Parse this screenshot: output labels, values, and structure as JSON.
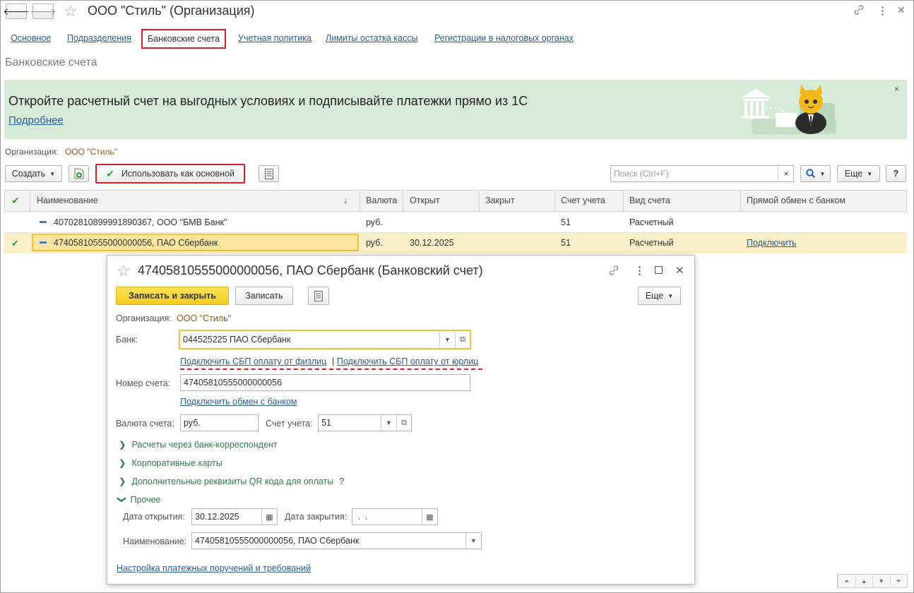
{
  "window": {
    "title": "ООО \"Стиль\" (Организация)"
  },
  "tabs": [
    {
      "label": "Основное"
    },
    {
      "label": "Подразделения"
    },
    {
      "label": "Банковские счета"
    },
    {
      "label": "Учетная политика"
    },
    {
      "label": "Лимиты остатка кассы"
    },
    {
      "label": "Регистрации в налоговых органах"
    }
  ],
  "section_title": "Банковские счета",
  "banner": {
    "text": "Откройте расчетный счет на выгодных условиях и подписывайте платежки прямо из 1С",
    "link": "Подробнее",
    "close": "×"
  },
  "org": {
    "label": "Организация:",
    "value": "ООО \"Стиль\""
  },
  "toolbar": {
    "create": "Создать",
    "use_as_main": "Использовать как основной",
    "search_placeholder": "Поиск (Ctrl+F)",
    "search_clear": "×",
    "more": "Еще",
    "help": "?"
  },
  "table": {
    "headers": [
      "Наименование",
      "Валюта",
      "Открыт",
      "Закрыт",
      "Счет учета",
      "Вид счета",
      "Прямой обмен с банком"
    ],
    "sort_indicator": "↓",
    "rows": [
      {
        "name": "40702810899991890367, ООО \"БМВ Банк\"",
        "currency": "руб.",
        "opened": "",
        "closed": "",
        "account": "51",
        "type": "Расчетный",
        "exchange": ""
      },
      {
        "name": "47405810555000000056, ПАО Сбербанк",
        "currency": "руб.",
        "opened": "30.12.2025",
        "closed": "",
        "account": "51",
        "type": "Расчетный",
        "exchange": "Подключить"
      }
    ]
  },
  "dialog": {
    "title": "47405810555000000056, ПАО Сбербанк (Банковский счет)",
    "save_close": "Записать и закрыть",
    "save": "Записать",
    "more": "Еще",
    "org_label": "Организация:",
    "org_value": "ООО \"Стиль\"",
    "bank_label": "Банк:",
    "bank_value": "044525225 ПАО Сбербанк",
    "sbp_individuals": "Подключить СБП оплату от физлиц",
    "sbp_separator": "|",
    "sbp_legal": "Подключить СБП оплату от юрлиц",
    "account_number_label": "Номер счета:",
    "account_number_value": "47405810555000000056",
    "connect_exchange": "Подключить обмен с банком",
    "currency_label": "Валюта счета:",
    "currency_value": "руб.",
    "ledger_label": "Счет учета:",
    "ledger_value": "51",
    "groups": [
      {
        "label": "Расчеты через банк-корреспондент"
      },
      {
        "label": "Корпоративные карты"
      },
      {
        "label": "Дополнительные реквизиты QR кода для оплаты"
      },
      {
        "label": "Прочее"
      }
    ],
    "qr_help": "?",
    "open_date_label": "Дата открытия:",
    "open_date_value": "30.12.2025",
    "close_date_label": "Дата закрытия:",
    "close_date_value": " .  .",
    "name_label": "Наименование:",
    "name_value": "47405810555000000056, ПАО Сбербанк",
    "settings_link": "Настройка платежных поручений и требований"
  },
  "colors": {
    "accent_red": "#d42027",
    "primary_yellow": "#f7d52a",
    "banner_green": "#d7ebd9",
    "selected_row": "#fbf0c9",
    "link_blue": "#2a5d9a",
    "group_green": "#2f7d4a"
  }
}
